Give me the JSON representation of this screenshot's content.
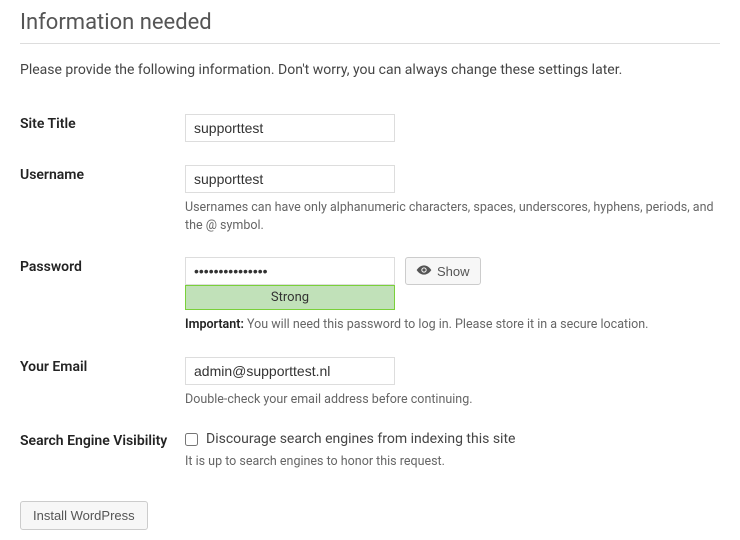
{
  "heading": "Information needed",
  "intro": "Please provide the following information. Don't worry, you can always change these settings later.",
  "fields": {
    "site_title": {
      "label": "Site Title",
      "value": "supporttest"
    },
    "username": {
      "label": "Username",
      "value": "supporttest",
      "desc": "Usernames can have only alphanumeric characters, spaces, underscores, hyphens, periods, and the @ symbol."
    },
    "password": {
      "label": "Password",
      "value": "•••••••••••••••",
      "show_btn": "Show",
      "strength": "Strong",
      "important_label": "Important:",
      "important_text": " You will need this password to log in. Please store it in a secure location."
    },
    "email": {
      "label": "Your Email",
      "value": "admin@supporttest.nl",
      "desc": "Double-check your email address before continuing."
    },
    "search_engine": {
      "label": "Search Engine Visibility",
      "checkbox_label": "Discourage search engines from indexing this site",
      "desc": "It is up to search engines to honor this request."
    }
  },
  "install_btn": "Install WordPress"
}
